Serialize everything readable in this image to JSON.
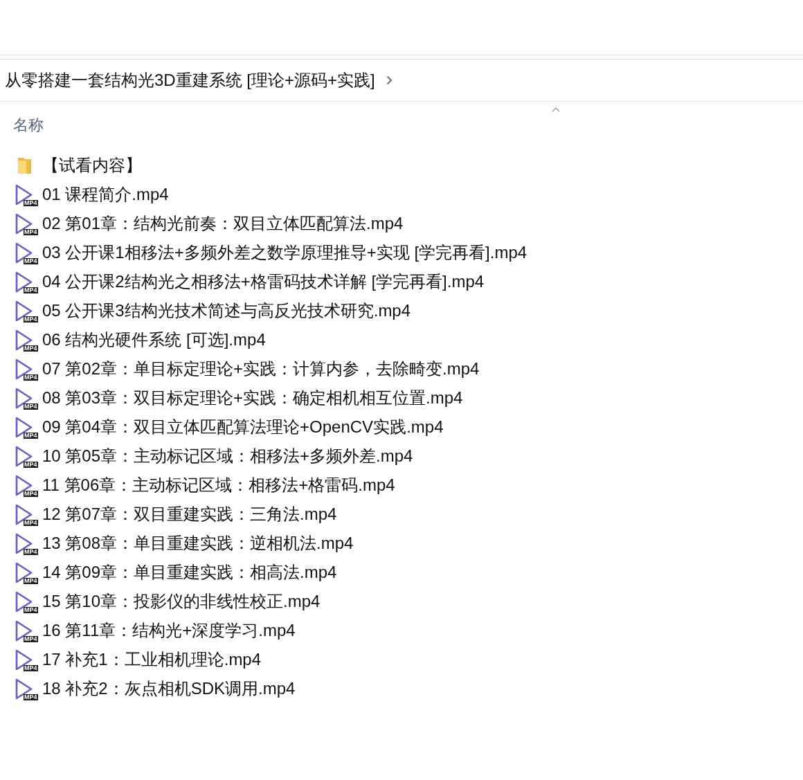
{
  "breadcrumb": {
    "path": "从零搭建一套结构光3D重建系统 [理论+源码+实践]"
  },
  "column_header": {
    "label": "名称",
    "sorted": true
  },
  "items": [
    {
      "kind": "folder",
      "name": "【试看内容】",
      "selected": false
    },
    {
      "kind": "video",
      "name": "01 课程简介.mp4",
      "badge": "MP4",
      "selected": false
    },
    {
      "kind": "video",
      "name": "02 第01章：结构光前奏：双目立体匹配算法.mp4",
      "badge": "MP4",
      "selected": false
    },
    {
      "kind": "video",
      "name": "03 公开课1相移法+多频外差之数学原理推导+实现 [学完再看].mp4",
      "badge": "MP4",
      "selected": false
    },
    {
      "kind": "video",
      "name": "04 公开课2结构光之相移法+格雷码技术详解 [学完再看].mp4",
      "badge": "MP4",
      "selected": false
    },
    {
      "kind": "video",
      "name": "05 公开课3结构光技术简述与高反光技术研究.mp4",
      "badge": "MP4",
      "selected": false
    },
    {
      "kind": "video",
      "name": "06 结构光硬件系统 [可选].mp4",
      "badge": "MP4",
      "selected": false
    },
    {
      "kind": "video",
      "name": "07 第02章：单目标定理论+实践：计算内参，去除畸变.mp4",
      "badge": "MP4",
      "selected": false
    },
    {
      "kind": "video",
      "name": "08 第03章：双目标定理论+实践：确定相机相互位置.mp4",
      "badge": "MP4",
      "selected": false
    },
    {
      "kind": "video",
      "name": "09 第04章：双目立体匹配算法理论+OpenCV实践.mp4",
      "badge": "MP4",
      "selected": false
    },
    {
      "kind": "video",
      "name": "10 第05章：主动标记区域：相移法+多频外差.mp4",
      "badge": "MP4",
      "selected": false
    },
    {
      "kind": "video",
      "name": "11 第06章：主动标记区域：相移法+格雷码.mp4",
      "badge": "MP4",
      "selected": false
    },
    {
      "kind": "video",
      "name": "12 第07章：双目重建实践：三角法.mp4",
      "badge": "MP4",
      "selected": false
    },
    {
      "kind": "video",
      "name": "13 第08章：单目重建实践：逆相机法.mp4",
      "badge": "MP4",
      "selected": false
    },
    {
      "kind": "video",
      "name": "14 第09章：单目重建实践：相高法.mp4",
      "badge": "MP4",
      "selected": false
    },
    {
      "kind": "video",
      "name": "15 第10章：投影仪的非线性校正.mp4",
      "badge": "MP4",
      "selected": false
    },
    {
      "kind": "video",
      "name": "16 第11章：结构光+深度学习.mp4",
      "badge": "MP4",
      "selected": false
    },
    {
      "kind": "video",
      "name": "17 补充1：工业相机理论.mp4",
      "badge": "MP4",
      "selected": false
    },
    {
      "kind": "video",
      "name": "18 补充2：灰点相机SDK调用.mp4",
      "badge": "MP4",
      "selected": false
    }
  ]
}
